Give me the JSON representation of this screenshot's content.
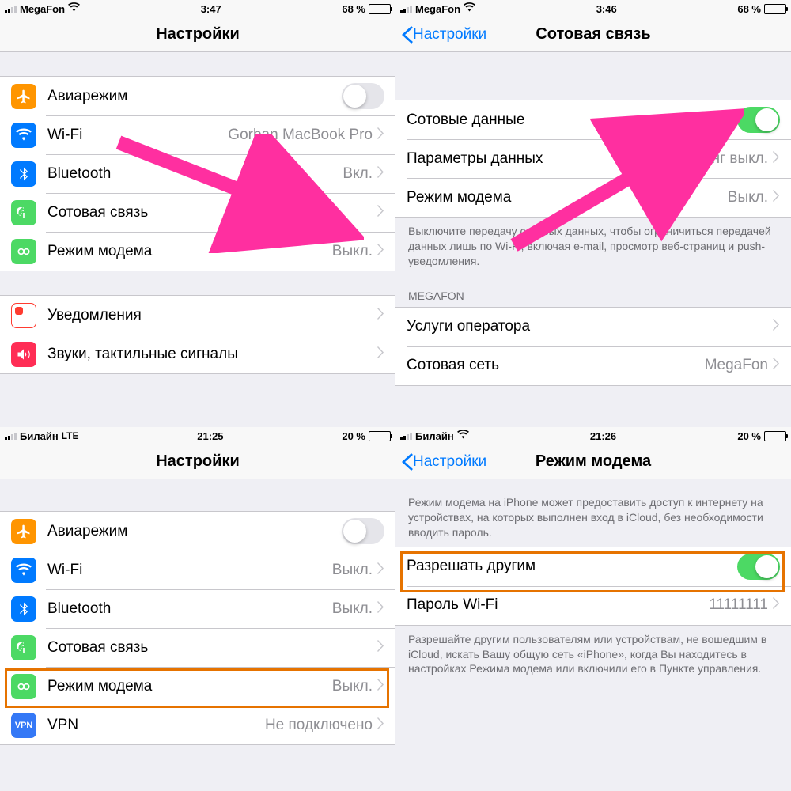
{
  "panes": {
    "tl": {
      "status": {
        "carrier": "MegaFon",
        "time": "3:47",
        "batt_pct": "68 %",
        "batt_fill": 68,
        "net": "wifi"
      },
      "title": "Настройки",
      "rows": [
        {
          "icon": "airplane",
          "label": "Авиарежим",
          "ctrl": "switch-off"
        },
        {
          "icon": "wifi",
          "label": "Wi-Fi",
          "detail": "Gorban MacBook Pro",
          "ctrl": "chev"
        },
        {
          "icon": "bluetooth",
          "label": "Bluetooth",
          "detail": "Вкл.",
          "ctrl": "chev"
        },
        {
          "icon": "cell",
          "label": "Сотовая связь",
          "detail": "",
          "ctrl": "chev"
        },
        {
          "icon": "hotspot",
          "label": "Режим модема",
          "detail": "Выкл.",
          "ctrl": "chev"
        }
      ],
      "rows2": [
        {
          "icon": "notif",
          "label": "Уведомления",
          "ctrl": "chev"
        },
        {
          "icon": "sounds",
          "label": "Звуки, тактильные сигналы",
          "ctrl": "chev"
        }
      ]
    },
    "tr": {
      "status": {
        "carrier": "MegaFon",
        "time": "3:46",
        "batt_pct": "68 %",
        "batt_fill": 68,
        "net": "wifi"
      },
      "back": "Настройки",
      "title": "Сотовая связь",
      "rows": [
        {
          "label": "Сотовые данные",
          "ctrl": "switch-on"
        },
        {
          "label": "Параметры данных",
          "detail": "Роуминг выкл.",
          "ctrl": "chev"
        },
        {
          "label": "Режим модема",
          "detail": "Выкл.",
          "ctrl": "chev"
        }
      ],
      "footer": "Выключите передачу сотовых данных, чтобы ограничиться передачей данных лишь по Wi-Fi, включая e-mail, просмотр веб-страниц и push-уведомления.",
      "header2": "MEGAFON",
      "rows2": [
        {
          "label": "Услуги оператора",
          "ctrl": "chev"
        },
        {
          "label": "Сотовая сеть",
          "detail": "MegaFon",
          "ctrl": "chev"
        }
      ]
    },
    "bl": {
      "status": {
        "carrier": "Билайн",
        "time": "21:25",
        "batt_pct": "20 %",
        "batt_fill": 20,
        "net": "LTE"
      },
      "title": "Настройки",
      "rows": [
        {
          "icon": "airplane",
          "label": "Авиарежим",
          "ctrl": "switch-off"
        },
        {
          "icon": "wifi",
          "label": "Wi-Fi",
          "detail": "Выкл.",
          "ctrl": "chev"
        },
        {
          "icon": "bluetooth",
          "label": "Bluetooth",
          "detail": "Выкл.",
          "ctrl": "chev"
        },
        {
          "icon": "cell",
          "label": "Сотовая связь",
          "ctrl": "chev"
        },
        {
          "icon": "hotspot",
          "label": "Режим модема",
          "detail": "Выкл.",
          "ctrl": "chev"
        },
        {
          "icon": "vpn",
          "label": "VPN",
          "detail": "Не подключено",
          "ctrl": "chev"
        }
      ]
    },
    "br": {
      "status": {
        "carrier": "Билайн",
        "time": "21:26",
        "batt_pct": "20 %",
        "batt_fill": 20,
        "net": "wifi"
      },
      "back": "Настройки",
      "title": "Режим модема",
      "intro": "Режим модема на iPhone может предоставить доступ к интернету на устройствах, на которых выполнен вход в iCloud, без необходимости вводить пароль.",
      "rows": [
        {
          "label": "Разрешать другим",
          "ctrl": "switch-on"
        },
        {
          "label": "Пароль Wi-Fi",
          "detail": "11111111",
          "ctrl": "chev"
        }
      ],
      "footer": "Разрешайте другим пользователям или устройствам, не вошедшим в iCloud, искать Вашу общую сеть «iPhone», когда Вы находитесь в настройках Режима модема или включили его в Пункте управления."
    }
  }
}
